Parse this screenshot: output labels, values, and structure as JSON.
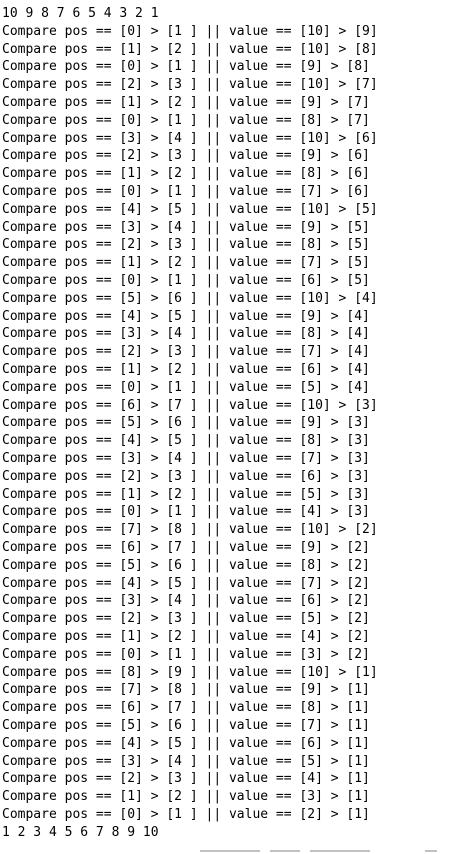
{
  "terminal": {
    "first_line": "10 9 8 7 6 5 4 3 2 1",
    "last_line": "1 2 3 4 5 6 7 8 9 10",
    "lines": [
      "Compare pos == [0] > [1 ] || value == [10] > [9]",
      "Compare pos == [1] > [2 ] || value == [10] > [8]",
      "Compare pos == [0] > [1 ] || value == [9] > [8]",
      "Compare pos == [2] > [3 ] || value == [10] > [7]",
      "Compare pos == [1] > [2 ] || value == [9] > [7]",
      "Compare pos == [0] > [1 ] || value == [8] > [7]",
      "Compare pos == [3] > [4 ] || value == [10] > [6]",
      "Compare pos == [2] > [3 ] || value == [9] > [6]",
      "Compare pos == [1] > [2 ] || value == [8] > [6]",
      "Compare pos == [0] > [1 ] || value == [7] > [6]",
      "Compare pos == [4] > [5 ] || value == [10] > [5]",
      "Compare pos == [3] > [4 ] || value == [9] > [5]",
      "Compare pos == [2] > [3 ] || value == [8] > [5]",
      "Compare pos == [1] > [2 ] || value == [7] > [5]",
      "Compare pos == [0] > [1 ] || value == [6] > [5]",
      "Compare pos == [5] > [6 ] || value == [10] > [4]",
      "Compare pos == [4] > [5 ] || value == [9] > [4]",
      "Compare pos == [3] > [4 ] || value == [8] > [4]",
      "Compare pos == [2] > [3 ] || value == [7] > [4]",
      "Compare pos == [1] > [2 ] || value == [6] > [4]",
      "Compare pos == [0] > [1 ] || value == [5] > [4]",
      "Compare pos == [6] > [7 ] || value == [10] > [3]",
      "Compare pos == [5] > [6 ] || value == [9] > [3]",
      "Compare pos == [4] > [5 ] || value == [8] > [3]",
      "Compare pos == [3] > [4 ] || value == [7] > [3]",
      "Compare pos == [2] > [3 ] || value == [6] > [3]",
      "Compare pos == [1] > [2 ] || value == [5] > [3]",
      "Compare pos == [0] > [1 ] || value == [4] > [3]",
      "Compare pos == [7] > [8 ] || value == [10] > [2]",
      "Compare pos == [6] > [7 ] || value == [9] > [2]",
      "Compare pos == [5] > [6 ] || value == [8] > [2]",
      "Compare pos == [4] > [5 ] || value == [7] > [2]",
      "Compare pos == [3] > [4 ] || value == [6] > [2]",
      "Compare pos == [2] > [3 ] || value == [5] > [2]",
      "Compare pos == [1] > [2 ] || value == [4] > [2]",
      "Compare pos == [0] > [1 ] || value == [3] > [2]",
      "Compare pos == [8] > [9 ] || value == [10] > [1]",
      "Compare pos == [7] > [8 ] || value == [9] > [1]",
      "Compare pos == [6] > [7 ] || value == [8] > [1]",
      "Compare pos == [5] > [6 ] || value == [7] > [1]",
      "Compare pos == [4] > [5 ] || value == [6] > [1]",
      "Compare pos == [3] > [4 ] || value == [5] > [1]",
      "Compare pos == [2] > [3 ] || value == [4] > [1]",
      "Compare pos == [1] > [2 ] || value == [3] > [1]",
      "Compare pos == [0] > [1 ] || value == [2] > [1]"
    ]
  },
  "colors": {
    "background": "#ffffff",
    "text": "#000000",
    "accent": "#d2342a"
  }
}
